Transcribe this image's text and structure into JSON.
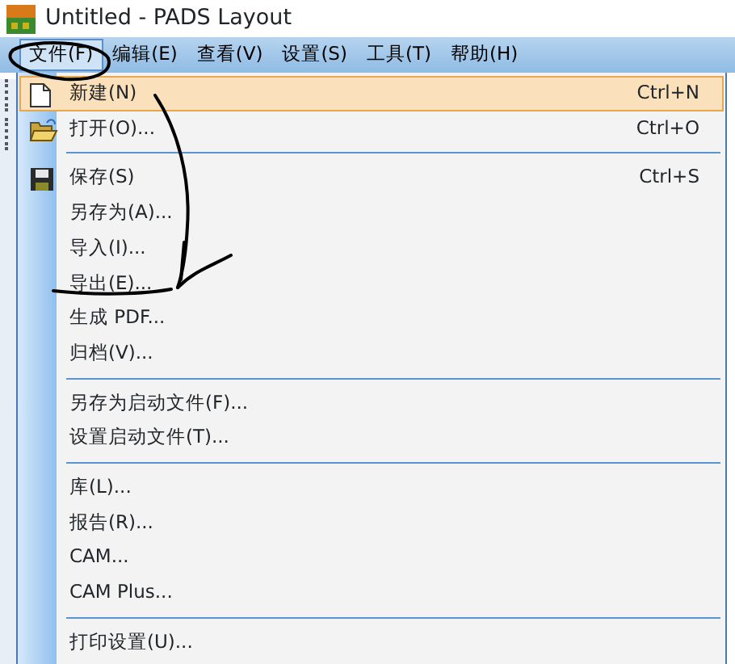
{
  "window": {
    "title": "Untitled - PADS Layout"
  },
  "menubar": [
    {
      "label": "文件(F)",
      "selected": true
    },
    {
      "label": "编辑(E)",
      "selected": false
    },
    {
      "label": "查看(V)",
      "selected": false
    },
    {
      "label": "设置(S)",
      "selected": false
    },
    {
      "label": "工具(T)",
      "selected": false
    },
    {
      "label": "帮助(H)",
      "selected": false
    }
  ],
  "menu": [
    {
      "kind": "item",
      "label": "新建(N)",
      "shortcut": "Ctrl+N",
      "selected": true
    },
    {
      "kind": "item",
      "label": "打开(O)...",
      "shortcut": "Ctrl+O",
      "selected": false
    },
    {
      "kind": "separator"
    },
    {
      "kind": "item",
      "label": "保存(S)",
      "shortcut": "Ctrl+S",
      "selected": false
    },
    {
      "kind": "item",
      "label": "另存为(A)...",
      "selected": false
    },
    {
      "kind": "item",
      "label": "导入(I)...",
      "selected": false
    },
    {
      "kind": "item",
      "label": "导出(E)...",
      "selected": false
    },
    {
      "kind": "item",
      "label": "生成 PDF...",
      "selected": false
    },
    {
      "kind": "item",
      "label": "归档(V)...",
      "selected": false
    },
    {
      "kind": "separator"
    },
    {
      "kind": "item",
      "label": "另存为启动文件(F)...",
      "selected": false
    },
    {
      "kind": "item",
      "label": "设置启动文件(T)...",
      "selected": false
    },
    {
      "kind": "separator"
    },
    {
      "kind": "item",
      "label": "库(L)...",
      "selected": false
    },
    {
      "kind": "item",
      "label": "报告(R)...",
      "selected": false
    },
    {
      "kind": "item",
      "label": "CAM...",
      "selected": false
    },
    {
      "kind": "item",
      "label": "CAM Plus...",
      "selected": false
    },
    {
      "kind": "separator"
    },
    {
      "kind": "item",
      "label": "打印设置(U)...",
      "selected": false
    }
  ]
}
